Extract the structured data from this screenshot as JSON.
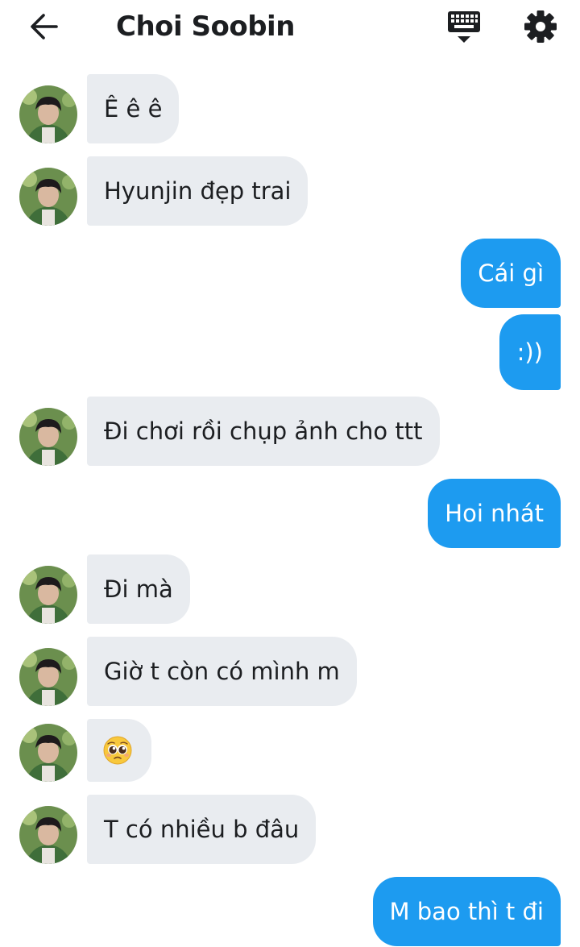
{
  "header": {
    "title": "Choi Soobin",
    "back_icon": "arrow-left-icon",
    "keyboard_icon": "keyboard-icon",
    "settings_icon": "gear-icon"
  },
  "colors": {
    "incoming_bubble": "#e9ecf0",
    "outgoing_bubble": "#1d9bf0",
    "outgoing_text": "#ffffff",
    "incoming_text": "#1c1e21"
  },
  "messages": [
    {
      "from": "them",
      "text": "Ê ê ê"
    },
    {
      "from": "them",
      "text": "Hyunjin đẹp trai"
    },
    {
      "from": "me",
      "text": "Cái gì"
    },
    {
      "from": "me",
      "text": ":))"
    },
    {
      "from": "them",
      "text": "Đi chơi rồi chụp ảnh cho ttt"
    },
    {
      "from": "me",
      "text": "Hoi nhát"
    },
    {
      "from": "them",
      "text": "Đi mà"
    },
    {
      "from": "them",
      "text": "Giờ t còn có mình m"
    },
    {
      "from": "them",
      "text": "🥺",
      "emoji": "pleading-face-emoji"
    },
    {
      "from": "them",
      "text": "T có nhiều b đâu"
    },
    {
      "from": "me",
      "text": "M bao thì t đi"
    }
  ]
}
